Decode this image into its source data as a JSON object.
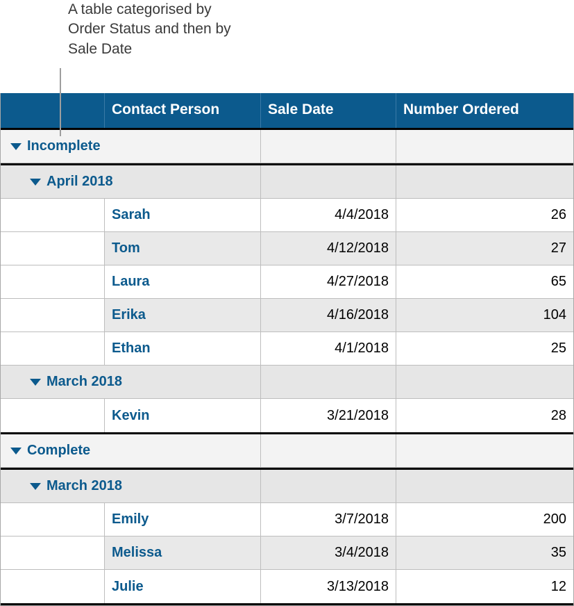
{
  "callout": "A table categorised by Order Status and then by Sale Date",
  "columns": {
    "contact": "Contact Person",
    "date": "Sale Date",
    "number": "Number Ordered"
  },
  "groups": [
    {
      "label": "Incomplete",
      "subgroups": [
        {
          "label": "April 2018",
          "rows": [
            {
              "contact": "Sarah",
              "date": "4/4/2018",
              "number": "26"
            },
            {
              "contact": "Tom",
              "date": "4/12/2018",
              "number": "27"
            },
            {
              "contact": "Laura",
              "date": "4/27/2018",
              "number": "65"
            },
            {
              "contact": "Erika",
              "date": "4/16/2018",
              "number": "104"
            },
            {
              "contact": "Ethan",
              "date": "4/1/2018",
              "number": "25"
            }
          ]
        },
        {
          "label": "March 2018",
          "rows": [
            {
              "contact": "Kevin",
              "date": "3/21/2018",
              "number": "28"
            }
          ]
        }
      ]
    },
    {
      "label": "Complete",
      "subgroups": [
        {
          "label": "March 2018",
          "rows": [
            {
              "contact": "Emily",
              "date": "3/7/2018",
              "number": "200"
            },
            {
              "contact": "Melissa",
              "date": "3/4/2018",
              "number": "35"
            },
            {
              "contact": "Julie",
              "date": "3/13/2018",
              "number": "12"
            }
          ]
        }
      ]
    }
  ]
}
